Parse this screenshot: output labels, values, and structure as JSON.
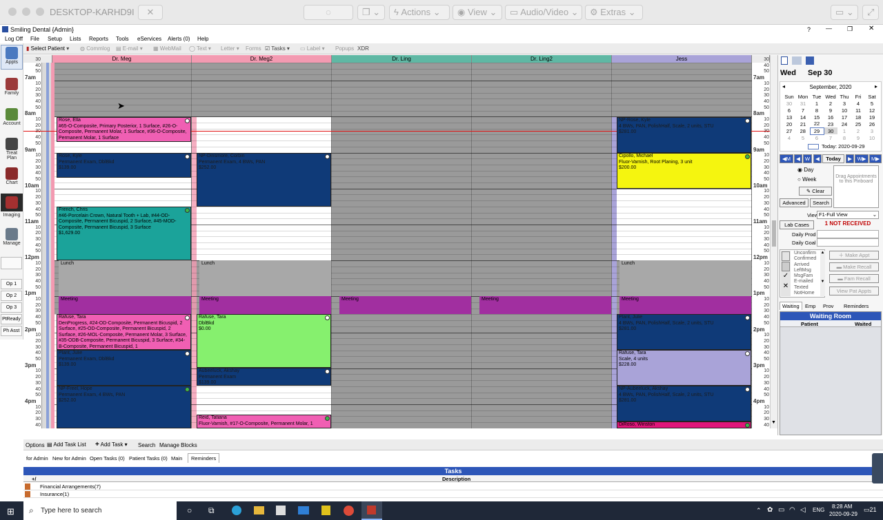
{
  "mac": {
    "window_title": "DESKTOP-KARHD9I",
    "actions": "Actions",
    "view": "View",
    "av": "Audio/Video",
    "extras": "Extras"
  },
  "app": {
    "title": "Smiling Dental {Admin}",
    "help": "?"
  },
  "menu": [
    "Log Off",
    "File",
    "Setup",
    "Lists",
    "Reports",
    "Tools",
    "eServices",
    "Alerts (0)",
    "Help"
  ],
  "toolbar": {
    "select_patient": "Select Patient",
    "commlog": "Commlog",
    "email": "E-mail",
    "webmail": "WebMail",
    "text": "Text",
    "letter": "Letter",
    "forms": "Forms",
    "tasks": "Tasks",
    "label": "Label",
    "popups": "Popups",
    "xdr": "XDR"
  },
  "leftbar": {
    "appts": "Appts",
    "family": "Family",
    "account": "Account",
    "treat": "Treat Plan",
    "chart": "Chart",
    "imaging": "Imaging",
    "manage": "Manage",
    "op1": "Op 1",
    "op2": "Op 2",
    "op3": "Op 3",
    "ptready": "PtReady",
    "phasst": "Ph Asst"
  },
  "providers": [
    {
      "name": "Dr. Meg",
      "color": "#f39ab1"
    },
    {
      "name": "Dr. Meg2",
      "color": "#f39ab1"
    },
    {
      "name": "Dr. Ling",
      "color": "#5fb8a4"
    },
    {
      "name": "Dr. Ling2",
      "color": "#5fb8a4"
    },
    {
      "name": "Jess",
      "color": "#a9a3d8"
    }
  ],
  "hours": [
    "7am",
    "8am",
    "9am",
    "10am",
    "11am",
    "12pm",
    "1pm",
    "2pm",
    "3pm",
    "4pm"
  ],
  "mins": [
    "10",
    "20",
    "30",
    "40",
    "50"
  ],
  "appts": {
    "a1": {
      "name": "Rose, Ella",
      "desc": "#65-O-Composite, Primary Posterior, 1 Surface, #26-O-Composite, Permanent Molar, 1 Surface, #36-O-Composite, Permanent Molar, 1 Surface"
    },
    "a2": {
      "name": "Rose, Kyle",
      "desc": "Permanent Exam, DblBkd",
      "fee": "$139.00"
    },
    "a3": {
      "name": "French, Chris",
      "desc": "#46-Porcelain Crown, Natural Tooth + Lab, #44-OD-Composite, Permanent Bicuspid, 2 Surface, #45-MOD-Composite, Permanent Bicuspid, 3 Surface",
      "fee": "$1,629.00"
    },
    "a4": {
      "name": "Rafuse, Tara",
      "desc": "DenProgress, #24-OD-Composite, Permanent Bicuspid, 2 Surface, #25-OD-Composite, Permanent Bicuspid, 2 Surface, #26-MOL-Composite, Permanent Molar, 3 Surface, #35-ODB-Composite, Permanent Bicuspid, 3 Surface, #34-B-Composite, Permanent Bicuspid, 1"
    },
    "a5": {
      "name": "Plant, Julie",
      "desc": "Permanent Exam, DblBkd",
      "fee": "$139.00"
    },
    "a6": {
      "name": "NP-Freel, Hope",
      "desc": "Permanent Exam, 4 BWs, PAN",
      "fee": "$252.00"
    },
    "b1": {
      "name": "NP-Dinsmore, Corbin",
      "desc": "Permanent Exam, 4 BWs, PAN",
      "fee": "$252.00"
    },
    "b2": {
      "name": "Rafuse, Tara",
      "desc": "DblBkd",
      "fee": "$0.00"
    },
    "b3": {
      "name": "Aubeeluck, Akshay",
      "desc": "Permanent Exam",
      "fee": "$139.00"
    },
    "b4": {
      "name": "Reid, Tatiana",
      "desc": "Fluor-Varnish, #17-O-Composite, Permanent Molar, 1"
    },
    "j1": {
      "name": "NP-Rose, Kyle",
      "desc": "4 BWs, PAN, PolishHalf, Scale, 2 units, STU",
      "fee": "$281.00"
    },
    "j2": {
      "name": "Cipollo, Michael",
      "desc": "Fluor-Varnish, Root Planing, 3 unit",
      "fee": "$200.00"
    },
    "j3": {
      "name": "Plant, Julie",
      "desc": "4 BWs, PAN, PolishHalf, Scale, 2 units, STU",
      "fee": "$281.00"
    },
    "j4": {
      "name": "Rafuse, Tara",
      "desc": "Scale, 4 units",
      "fee": "$228.00"
    },
    "j5": {
      "name": "NP-Aubeeluck, Akshay",
      "desc": "4 BWs, PAN, PolishHalf, Scale, 2 units, STU",
      "fee": "$281.00"
    },
    "j6": {
      "name": "DiRoso, Winston"
    }
  },
  "blocks": {
    "lunch": "Lunch",
    "meeting": "Meeting"
  },
  "right": {
    "day": "Wed",
    "date": "Sep 30",
    "month": "September, 2020",
    "dow": [
      "Sun",
      "Mon",
      "Tue",
      "Wed",
      "Thu",
      "Fri",
      "Sat"
    ],
    "weeks": [
      [
        "30",
        "31",
        "1",
        "2",
        "3",
        "4",
        "5"
      ],
      [
        "6",
        "7",
        "8",
        "9",
        "10",
        "11",
        "12"
      ],
      [
        "13",
        "14",
        "15",
        "16",
        "17",
        "18",
        "19"
      ],
      [
        "20",
        "21",
        "22",
        "23",
        "24",
        "25",
        "26"
      ],
      [
        "27",
        "28",
        "29",
        "30",
        "1",
        "2",
        "3"
      ],
      [
        "4",
        "5",
        "6",
        "7",
        "8",
        "9",
        "10"
      ]
    ],
    "today": "Today: 2020-09-29",
    "today_btn": "Today",
    "m": "M",
    "w": "W",
    "day_opt": "Day",
    "week_opt": "Week",
    "clear": "Clear",
    "advanced": "Advanced",
    "search": "Search",
    "pinboard": "Drag Appointments to this Pinboard",
    "view_label": "View",
    "view_value": "F1-Full View",
    "lab_cases": "Lab Cases",
    "not_received": "1 NOT RECEIVED",
    "daily_prod": "Daily Prod",
    "daily_goal": "Daily Goal",
    "statuses": [
      "Unconfirm",
      "Confirmed",
      "Arrived",
      "LeftMsg",
      "MsgFam",
      "E-mailed",
      "Texted",
      "NotHome"
    ],
    "make_appt": "Make Appt",
    "make_recall": "Make Recall",
    "fam_recall": "Fam Recall",
    "view_pat": "View Pat Appts",
    "tabs": [
      "Waiting",
      "Emp",
      "Prov",
      "Reminders"
    ],
    "waiting_room": "Waiting Room",
    "patient": "Patient",
    "waited": "Waited"
  },
  "bottom": {
    "options": "Options",
    "add_task_list": "Add Task List",
    "add_task": "Add Task",
    "search": "Search",
    "manage_blocks": "Manage Blocks",
    "tabs": [
      "for Admin",
      "New for Admin",
      "Open Tasks (0)",
      "Patient Tasks (0)",
      "Main",
      "Reminders"
    ],
    "tasks_title": "Tasks",
    "plus": "+/",
    "description": "Description",
    "rows": [
      "Financial Arrangements(7)",
      "Insurance(1)"
    ]
  },
  "taskbar": {
    "search": "Type here to search",
    "lang": "ENG",
    "time": "8:28 AM",
    "date": "2020-09-29",
    "badge": "21"
  }
}
